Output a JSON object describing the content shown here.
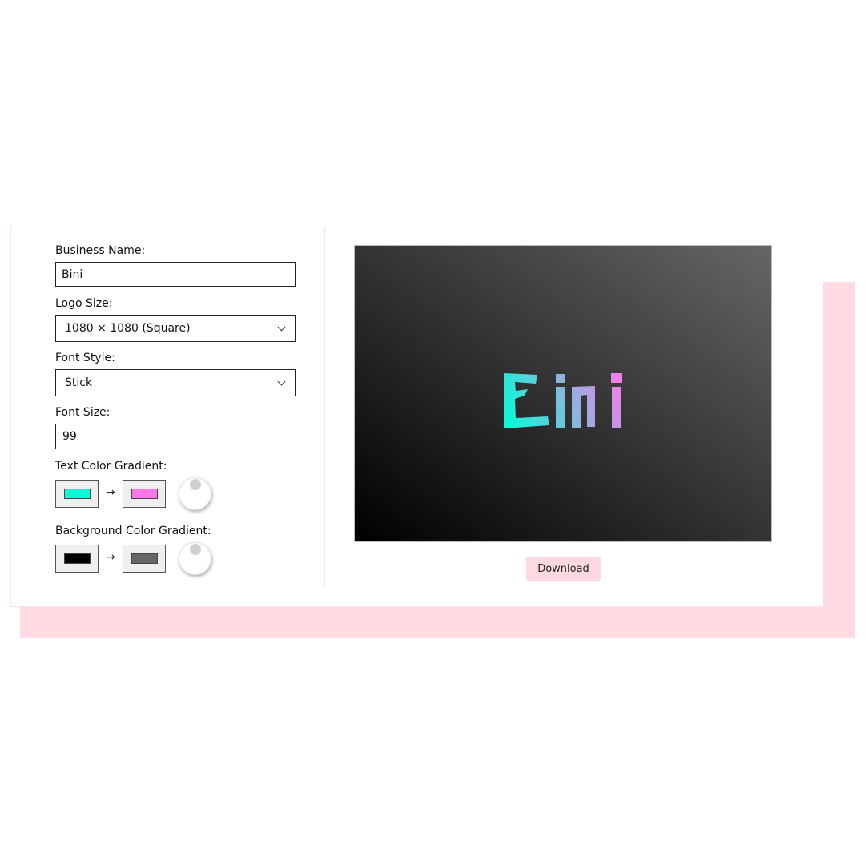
{
  "form": {
    "business_name_label": "Business Name:",
    "business_name_value": "Bini",
    "logo_size_label": "Logo Size:",
    "logo_size_selected": "1080 × 1080 (Square)",
    "font_style_label": "Font Style:",
    "font_style_selected": "Stick",
    "font_size_label": "Font Size:",
    "font_size_value": "99",
    "text_gradient_label": "Text Color Gradient:",
    "text_gradient_from": "#00ffd5",
    "text_gradient_to": "#ff77e9",
    "background_gradient_label": "Background Color Gradient:",
    "background_gradient_from": "#000000",
    "background_gradient_to": "#666666",
    "arrow": "→"
  },
  "preview": {
    "logo_text": "Bini"
  },
  "actions": {
    "download_label": "Download"
  },
  "colors": {
    "accent": "#ffdbe3"
  }
}
